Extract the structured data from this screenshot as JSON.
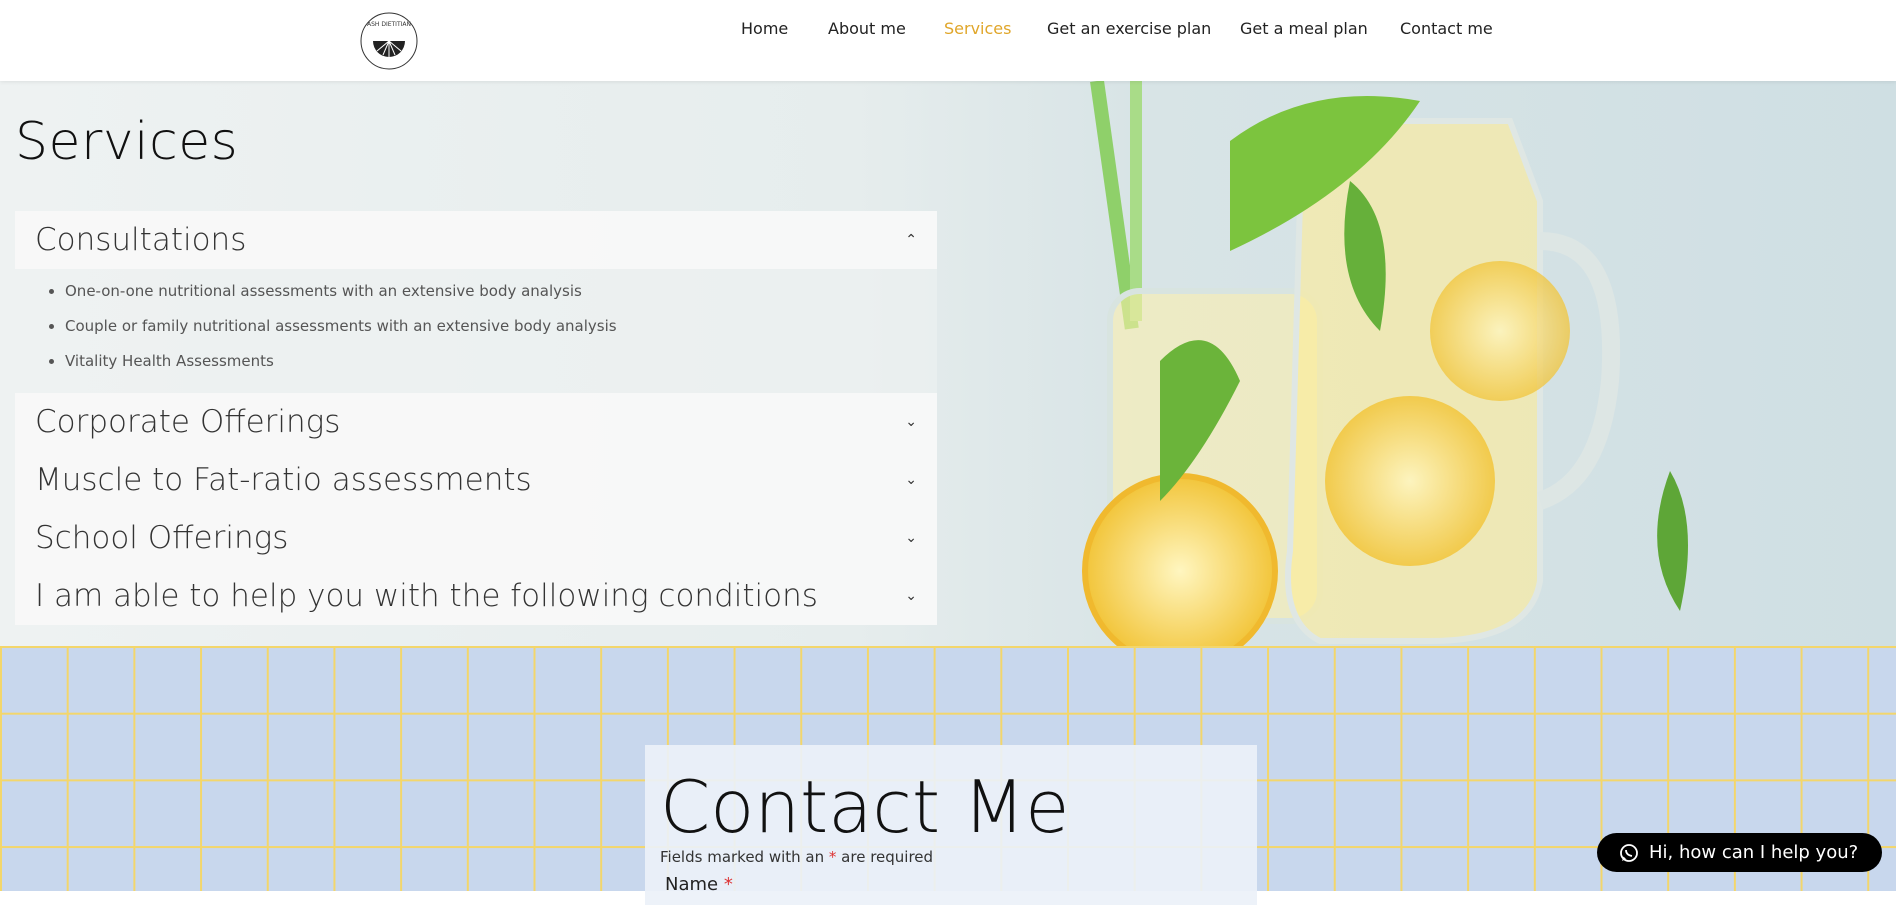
{
  "logo": {
    "text": "ASH the DIETITIAN"
  },
  "nav": {
    "items": [
      {
        "label": "Home"
      },
      {
        "label": "About me"
      },
      {
        "label": "Services",
        "active": true
      },
      {
        "label": "Get an exercise plan"
      },
      {
        "label": "Get a meal plan"
      },
      {
        "label": "Contact me"
      }
    ],
    "active_color": "#e0a62a"
  },
  "services": {
    "title": "Services",
    "sections": [
      {
        "label": "Consultations",
        "expanded": true,
        "items": [
          "One-on-one nutritional assessments with an extensive body analysis",
          "Couple or family nutritional assessments with an extensive body analysis",
          "Vitality Health Assessments"
        ]
      },
      {
        "label": "Corporate Offerings",
        "expanded": false
      },
      {
        "label": "Muscle to Fat-ratio assessments",
        "expanded": false
      },
      {
        "label": "School Offerings",
        "expanded": false
      },
      {
        "label": "I am able to help you with the following conditions",
        "expanded": false
      }
    ]
  },
  "contact": {
    "title": "Contact Me",
    "note_prefix": "Fields marked with an ",
    "note_star": "*",
    "note_suffix": " are required",
    "name_label": "Name ",
    "name_star": "*"
  },
  "chat": {
    "label": "Hi, how can I help you?",
    "icon": "whatsapp-icon"
  }
}
